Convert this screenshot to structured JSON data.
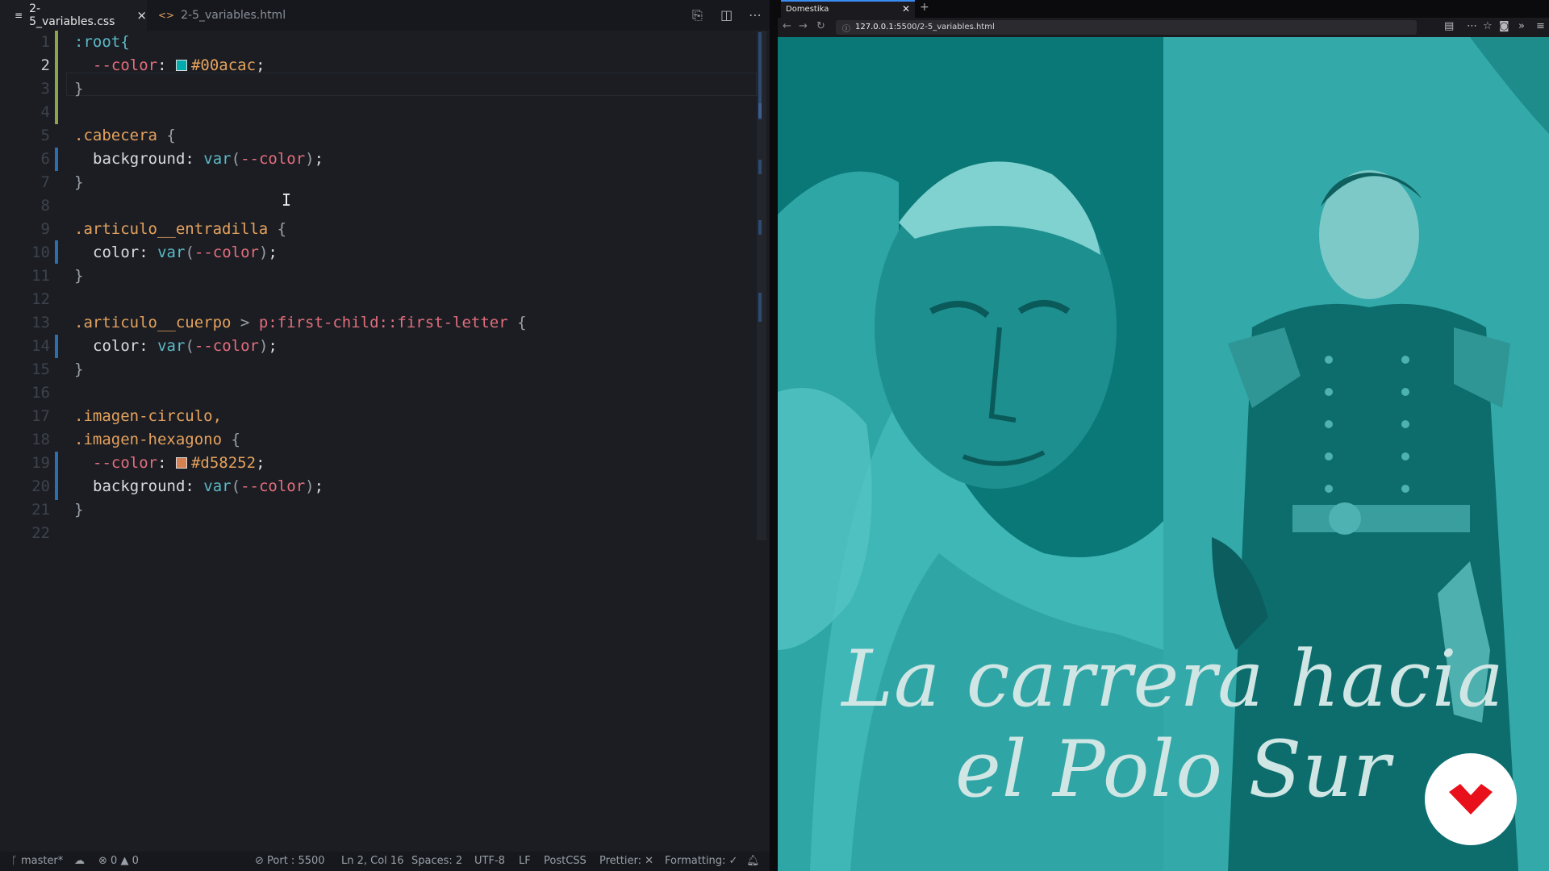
{
  "editor": {
    "tabs": [
      {
        "label": "2-5_variables.css",
        "icon": "file-lines-icon"
      },
      {
        "label": "2-5_variables.html",
        "icon": "html-code-icon"
      }
    ],
    "tab_close": "×",
    "line_numbers": [
      "1",
      "2",
      "3",
      "4",
      "5",
      "6",
      "7",
      "8",
      "9",
      "10",
      "11",
      "12",
      "13",
      "14",
      "15",
      "16",
      "17",
      "18",
      "19",
      "20",
      "21",
      "22"
    ],
    "code_tokens": {
      "root_sel": ":root{",
      "color_var": "--color",
      "colon": ":",
      "semi": ";",
      "color1": "#00acac",
      "color2": "#d58252",
      "close_brace": "}",
      "cabecera": ".cabecera",
      "open_brace": "{",
      "background": "background",
      "var_fn": "var",
      "paren_open": "(",
      "paren_close": ")",
      "entradilla": ".articulo__entradilla",
      "color_prop": "color",
      "cuerpo": ".articulo__cuerpo",
      "child": ">",
      "pseudo": "p:first-child::first-letter",
      "circulo": ".imagen-circulo,",
      "hexagono": ".imagen-hexagono"
    },
    "status": {
      "branch": "master*",
      "errors": "0",
      "warnings": "0",
      "port": "Port : 5500",
      "position": "Ln 2, Col 16",
      "spaces": "Spaces: 2",
      "encoding": "UTF-8",
      "eol": "LF",
      "language": "PostCSS",
      "prettier": "Prettier: ✕",
      "formatting": "Formatting: ✓"
    },
    "swatch_colors": {
      "teal": "#00acac",
      "orange": "#d58252"
    }
  },
  "browser": {
    "tab_title": "Domestika",
    "url_host": "127.0.0.1",
    "url_path": ":5500/2-5_variables.html",
    "headline_line1": "La carrera hacia",
    "headline_line2": "el Polo Sur",
    "accent": "#0d7f7f",
    "logo_color": "#e8101a"
  }
}
